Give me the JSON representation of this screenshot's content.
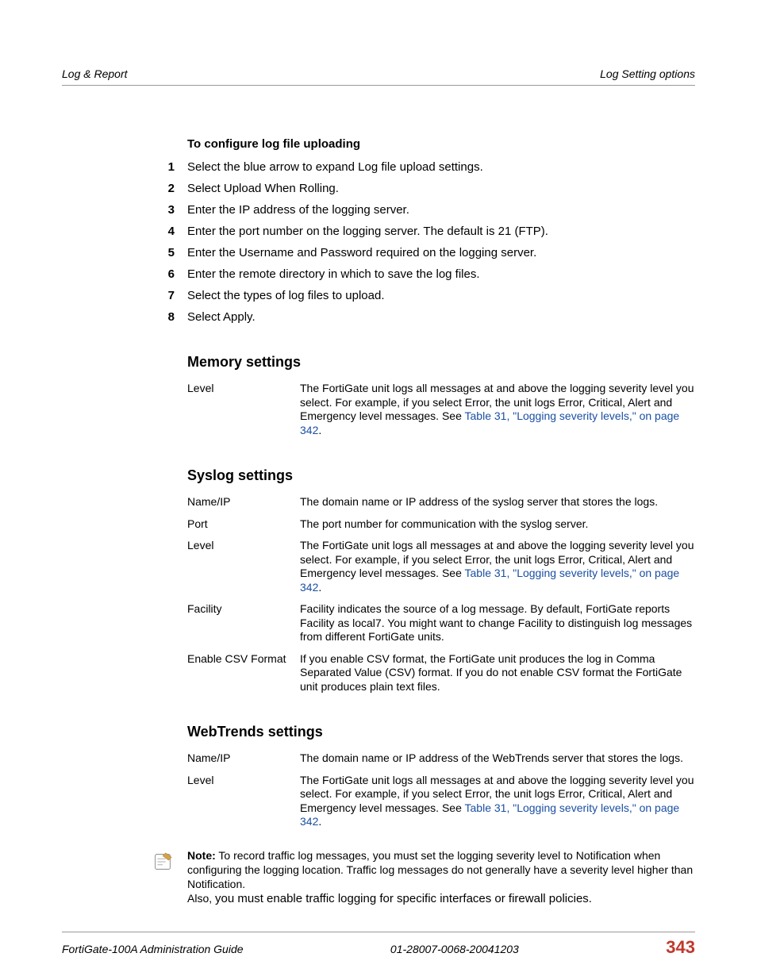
{
  "header": {
    "left": "Log & Report",
    "right": "Log Setting options"
  },
  "procedure": {
    "title": "To configure log file uploading",
    "steps": [
      "Select the blue arrow to expand Log file upload settings.",
      "Select Upload When Rolling.",
      "Enter the IP address of the logging server.",
      "Enter the port number on the logging server. The default is 21 (FTP).",
      "Enter the Username and Password required on the logging server.",
      "Enter the remote directory in which to save the log files.",
      "Select the types of log files to upload.",
      "Select Apply."
    ]
  },
  "memory": {
    "heading": "Memory settings",
    "rows": [
      {
        "term": "Level",
        "desc_pre": "The FortiGate unit logs all messages at and above the logging severity level you select. For example, if you select Error, the unit logs Error, Critical, Alert and Emergency level messages. See ",
        "link": "Table 31, \"Logging severity levels,\" on page 342",
        "desc_post": "."
      }
    ]
  },
  "syslog": {
    "heading": "Syslog settings",
    "rows": [
      {
        "term": "Name/IP",
        "desc": "The domain name or IP address of the syslog server that stores the logs."
      },
      {
        "term": "Port",
        "desc": "The port number for communication with the syslog server."
      },
      {
        "term": "Level",
        "desc_pre": "The FortiGate unit logs all messages at and above the logging severity level you select. For example, if you select Error, the unit logs Error, Critical, Alert and Emergency level messages. See ",
        "link": "Table 31, \"Logging severity levels,\" on page 342",
        "desc_post": "."
      },
      {
        "term": "Facility",
        "desc": "Facility indicates the source of a log message. By default, FortiGate reports Facility as local7. You might want to change Facility to distinguish log messages from different FortiGate units."
      },
      {
        "term": "Enable CSV Format",
        "desc": "If you enable CSV format, the FortiGate unit produces the log in Comma Separated Value (CSV) format. If you do not enable CSV format the FortiGate unit produces plain text files."
      }
    ]
  },
  "webtrends": {
    "heading": "WebTrends settings",
    "rows": [
      {
        "term": "Name/IP",
        "desc": "The domain name or IP address of the WebTrends server that stores the logs."
      },
      {
        "term": "Level",
        "desc_pre": "The FortiGate unit logs all messages at and above the logging severity level you select. For example, if you select Error, the unit logs Error, Critical, Alert and Emergency level messages. See ",
        "link": "Table 31, \"Logging severity levels,\" on page 342",
        "desc_post": "."
      }
    ]
  },
  "note": {
    "label": "Note:",
    "line1": " To record traffic log messages, you must set the logging severity level to Notification when configuring the logging location. Traffic log messages do not generally have a severity level higher than Notification.",
    "also": "Also, ",
    "line2": "you must enable traffic logging for specific interfaces or firewall policies."
  },
  "footer": {
    "left": "FortiGate-100A Administration Guide",
    "center": "01-28007-0068-20041203",
    "page": "343"
  }
}
